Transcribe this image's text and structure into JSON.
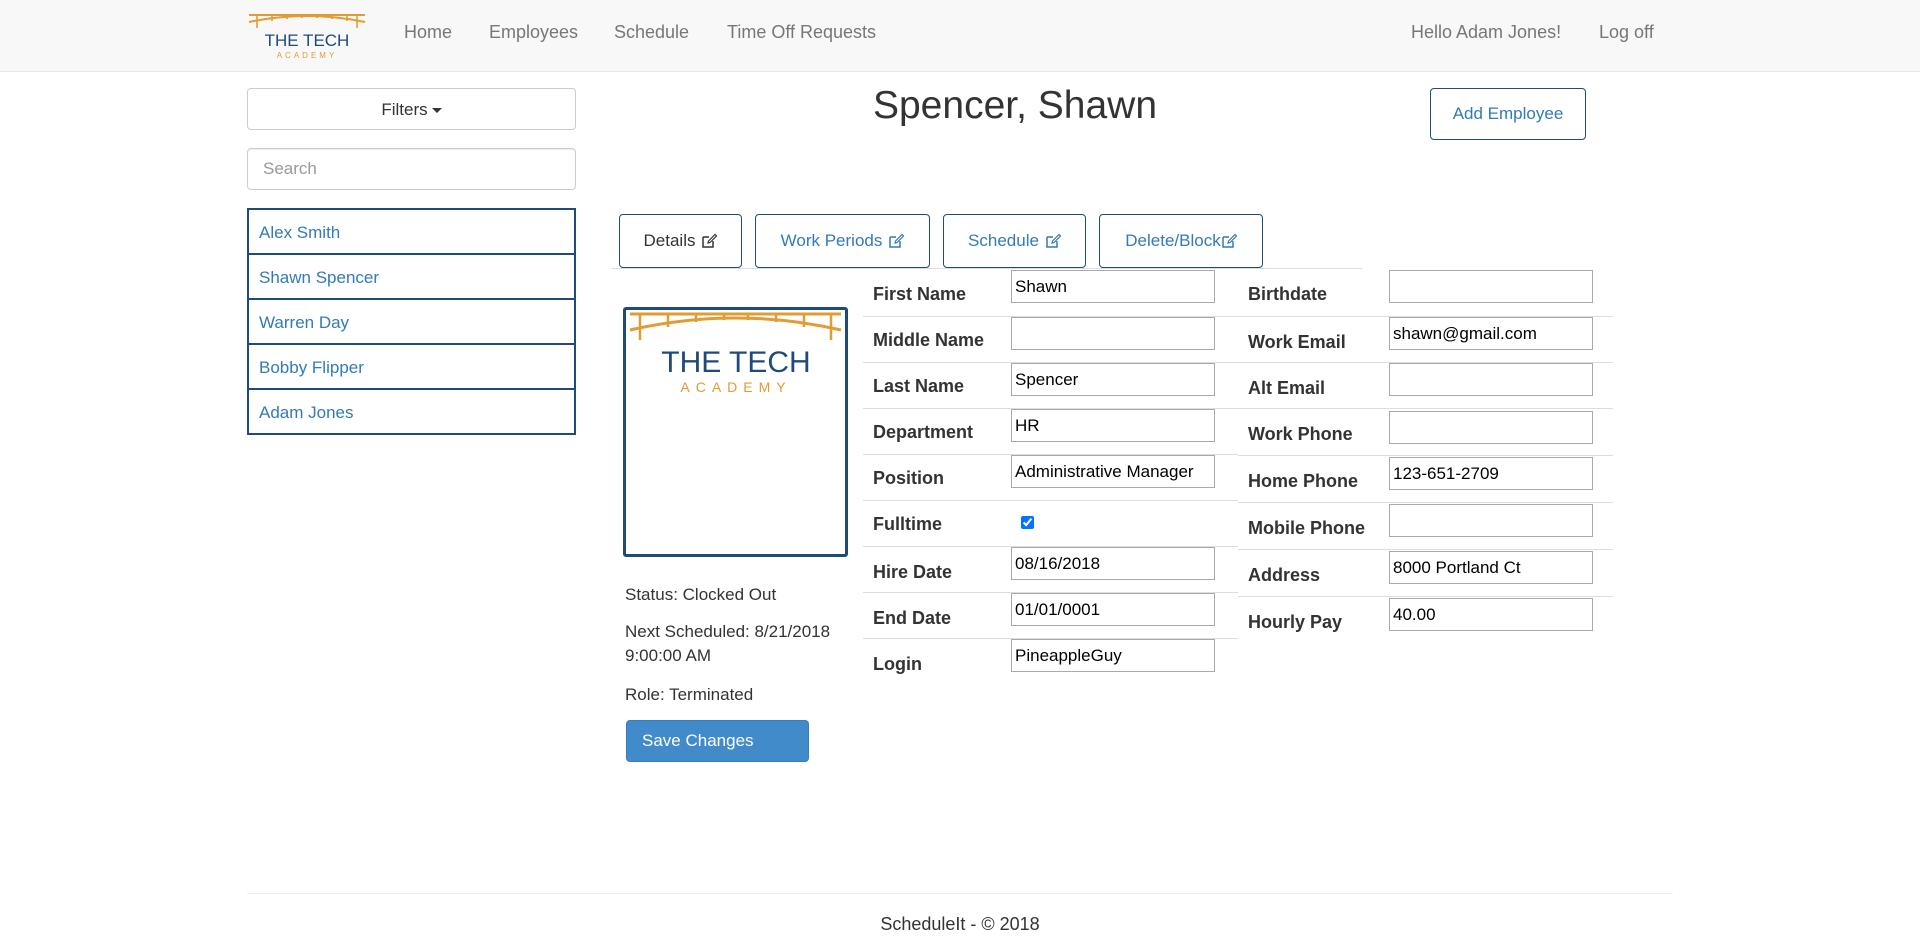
{
  "nav": {
    "brand": {
      "line1": "THE TECH",
      "line2": "ACADEMY"
    },
    "links": [
      "Home",
      "Employees",
      "Schedule",
      "Time Off Requests"
    ],
    "greeting": "Hello Adam Jones!",
    "logoff": "Log off"
  },
  "sidebar": {
    "filters_label": "Filters",
    "search_placeholder": "Search",
    "employees": [
      "Alex Smith",
      "Shawn Spencer",
      "Warren Day",
      "Bobby Flipper",
      "Adam Jones"
    ]
  },
  "header": {
    "title": "Spencer, Shawn",
    "add_employee": "Add Employee"
  },
  "tabs": [
    "Details",
    "Work Periods",
    "Schedule",
    "Delete/Block"
  ],
  "photo_logo": {
    "line1": "THE TECH",
    "line2": "ACADEMY"
  },
  "status": {
    "status": "Status: Clocked Out",
    "next_line1": "Next Scheduled: 8/21/2018",
    "next_line2": "9:00:00 AM",
    "role": "Role: Terminated",
    "save": "Save Changes"
  },
  "form_left": {
    "first_name": {
      "label": "First Name",
      "value": "Shawn"
    },
    "middle_name": {
      "label": "Middle Name",
      "value": ""
    },
    "last_name": {
      "label": "Last Name",
      "value": "Spencer"
    },
    "department": {
      "label": "Department",
      "value": "HR"
    },
    "position": {
      "label": "Position",
      "value": "Administrative Manager"
    },
    "fulltime": {
      "label": "Fulltime",
      "checked": true
    },
    "hire_date": {
      "label": "Hire Date",
      "value": "08/16/2018"
    },
    "end_date": {
      "label": "End Date",
      "value": "01/01/0001"
    },
    "login": {
      "label": "Login",
      "value": "PineappleGuy"
    }
  },
  "form_right": {
    "birthdate": {
      "label": "Birthdate",
      "value": ""
    },
    "work_email": {
      "label": "Work Email",
      "value": "shawn@gmail.com"
    },
    "alt_email": {
      "label": "Alt Email",
      "value": ""
    },
    "work_phone": {
      "label": "Work Phone",
      "value": ""
    },
    "home_phone": {
      "label": "Home Phone",
      "value": "123-651-2709"
    },
    "mobile_phone": {
      "label": "Mobile Phone",
      "value": ""
    },
    "address": {
      "label": "Address",
      "value": "8000 Portland Ct"
    },
    "hourly_pay": {
      "label": "Hourly Pay",
      "value": "40.00"
    }
  },
  "footer": {
    "text": "ScheduleIt - © 2018"
  },
  "colors": {
    "primary": "#337ab7",
    "border_dark": "#1f4b7a",
    "brand_orange": "#e39b35",
    "brand_blue": "#1f4b7a",
    "save_button": "#428bca"
  }
}
